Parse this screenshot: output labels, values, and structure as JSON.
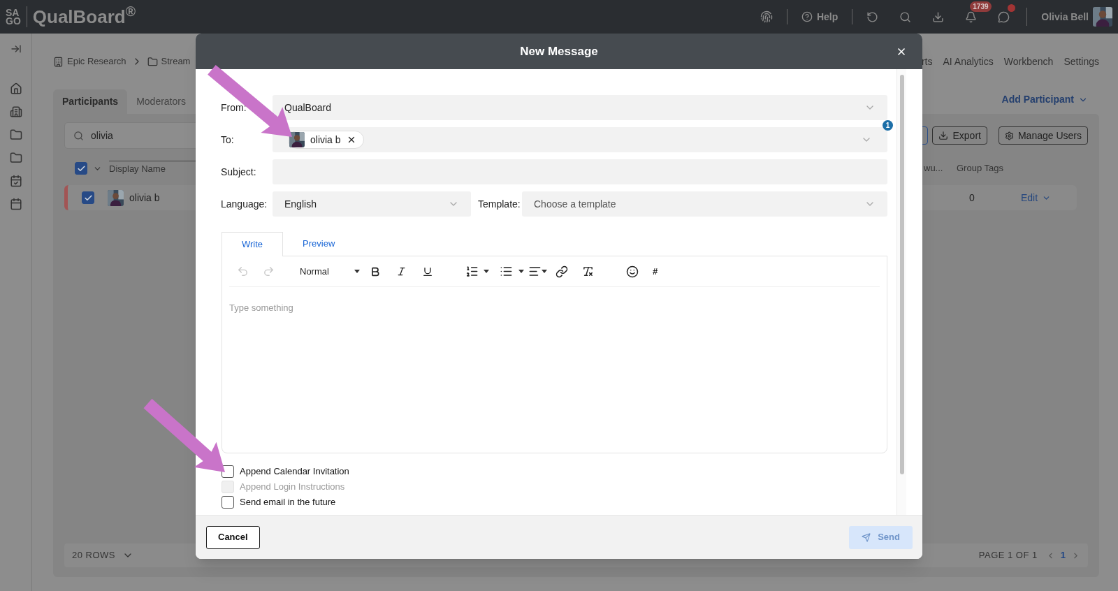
{
  "top_bar": {
    "logo_top": "SA",
    "logo_bottom": "GO",
    "app_name": "QualBoard$^{®}$",
    "help": "Help",
    "notification_count": "1739",
    "user_name": "Olivia Bell"
  },
  "breadcrumb": [
    "Epic Research",
    "Stream"
  ],
  "nav": [
    "rts",
    "AI Analytics",
    "Workbench",
    "Settings"
  ],
  "tabs": [
    {
      "label": "Participants",
      "selected": true
    },
    {
      "label": "Moderators",
      "selected": false
    }
  ],
  "add_participant": "Add Participant",
  "search": {
    "value": "olivia"
  },
  "actions": [
    "Export",
    "Manage Users"
  ],
  "table": {
    "header_checked": true,
    "columns": [
      "Display Name",
      "wu...",
      "Group Tags"
    ],
    "rows": [
      {
        "checked": true,
        "name": "olivia b",
        "group_tags": "0",
        "action": "Edit"
      }
    ]
  },
  "pagination": {
    "rows": "20 ROWS",
    "page": "PAGE 1 OF 1",
    "current": "1"
  },
  "modal": {
    "title": "New Message",
    "from": {
      "label": "From:",
      "value": "QualBoard"
    },
    "to": {
      "label": "To:",
      "recipients": [
        {
          "name": "olivia b"
        }
      ],
      "count": "1"
    },
    "subject": {
      "label": "Subject:"
    },
    "language": {
      "label": "Language:",
      "value": "English"
    },
    "template": {
      "label": "Template:",
      "placeholder": "Choose a template"
    },
    "tabs": [
      {
        "label": "Write",
        "selected": true
      },
      {
        "label": "Preview",
        "selected": false
      }
    ],
    "editor": {
      "undo_disabled": true,
      "redo_disabled": true,
      "style": "Normal",
      "hash": "#",
      "placeholder": "Type something"
    },
    "options": [
      {
        "label": "Append Calendar Invitation",
        "checked": false,
        "disabled": false
      },
      {
        "label": "Append Login Instructions",
        "checked": false,
        "disabled": true
      },
      {
        "label": "Send email in the future",
        "checked": false,
        "disabled": false
      }
    ],
    "cancel": "Cancel",
    "send": {
      "label": "Send",
      "disabled": true
    }
  }
}
